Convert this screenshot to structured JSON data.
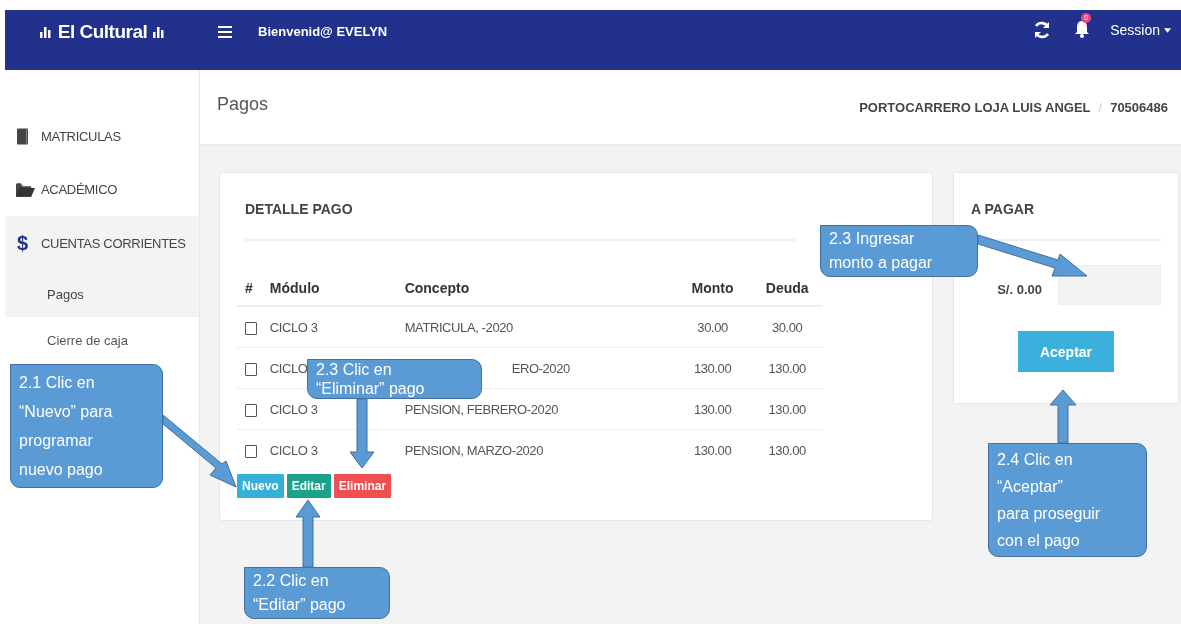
{
  "brand": {
    "name": "El Cultural"
  },
  "topbar": {
    "greeting": "Bienvenid@ EVELYN",
    "notification_count": "0",
    "session": "Session"
  },
  "sidebar": {
    "items": [
      {
        "label": "MATRICULAS",
        "kind": "book",
        "expanded": false
      },
      {
        "label": "ACADÉMICO",
        "kind": "folder",
        "expanded": false
      },
      {
        "label": "CUENTAS CORRIENTES",
        "kind": "dollar",
        "icon": "$",
        "expanded": true,
        "children": [
          {
            "label": "Pagos",
            "selected": true
          },
          {
            "label": "Cierre de caja",
            "selected": false
          }
        ]
      }
    ]
  },
  "page": {
    "title": "Pagos",
    "student": "PORTOCARRERO LOJA LUIS ANGEL",
    "separator": "/",
    "code": "70506486"
  },
  "detail": {
    "title": "DETALLE PAGO",
    "columns": [
      "#",
      "Módulo",
      "Concepto",
      "Monto",
      "Deuda"
    ],
    "rows": [
      {
        "checked": false,
        "modulo": "CICLO 3",
        "concepto": "MATRICULA, -2020",
        "concepto_cut": false,
        "monto": "30.00",
        "deuda": "30.00"
      },
      {
        "checked": false,
        "modulo": "CICLO",
        "concepto": "ERO-2020",
        "concepto_cut": true,
        "monto": "130.00",
        "deuda": "130.00"
      },
      {
        "checked": false,
        "modulo": "CICLO 3",
        "concepto": "PENSION, FEBRERO-2020",
        "concepto_cut": false,
        "monto": "130.00",
        "deuda": "130.00"
      },
      {
        "checked": false,
        "modulo": "CICLO 3",
        "concepto": "PENSION, MARZO-2020",
        "concepto_cut": false,
        "monto": "130.00",
        "deuda": "130.00"
      }
    ],
    "buttons": [
      {
        "label": "Nuevo",
        "kind": "info"
      },
      {
        "label": "Editar",
        "kind": "success"
      },
      {
        "label": "Eliminar",
        "kind": "danger"
      }
    ]
  },
  "payment": {
    "title": "A PAGAR",
    "amount": "S/. 0.00",
    "button": "Aceptar"
  },
  "callouts": [
    {
      "lines": [
        "2.1 Clic en",
        "“Nuevo” para",
        "programar",
        "nuevo pago"
      ]
    },
    {
      "lines": [
        "2.3 Clic en",
        "“Eliminar” pago"
      ]
    },
    {
      "lines": [
        "2.2 Clic en",
        "“Editar” pago"
      ]
    },
    {
      "lines": [
        "2.3 Ingresar",
        "monto a pagar"
      ]
    },
    {
      "lines": [
        "2.4 Clic en",
        "“Aceptar”",
        "para proseguir",
        "con el pago"
      ]
    }
  ]
}
